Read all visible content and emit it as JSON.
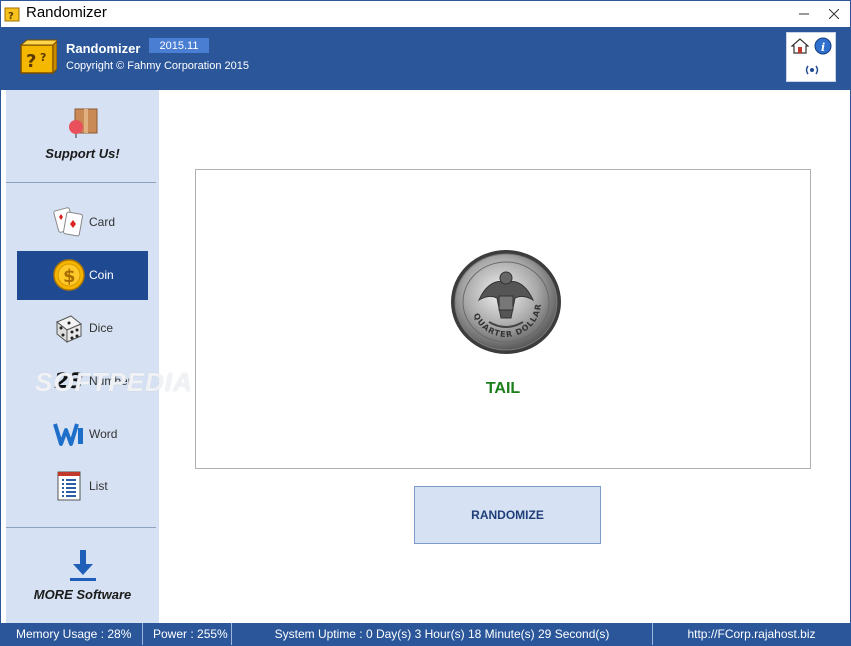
{
  "window": {
    "title": "Randomizer"
  },
  "header": {
    "app_name": "Randomizer",
    "version": "2015.11",
    "copyright": "Copyright © Fahmy Corporation 2015"
  },
  "sidebar": {
    "support_label": "Support Us!",
    "items": [
      {
        "label": "Card",
        "icon": "playing-cards-icon"
      },
      {
        "label": "Coin",
        "icon": "coin-icon",
        "active": true
      },
      {
        "label": "Dice",
        "icon": "dice-icon"
      },
      {
        "label": "Number",
        "icon": "number-icon",
        "glyph": "23"
      },
      {
        "label": "Word",
        "icon": "word-icon"
      },
      {
        "label": "List",
        "icon": "list-icon"
      }
    ],
    "more_label": "MORE Software"
  },
  "main": {
    "result": "TAIL",
    "randomize_label": "RANDOMIZE",
    "coin_text": "QUARTER DOLLAR"
  },
  "statusbar": {
    "memory": "Memory Usage : 28%",
    "power": "Power : 255%",
    "uptime": "System Uptime : 0 Day(s) 3 Hour(s) 18 Minute(s) 29 Second(s)",
    "url": "http://FCorp.rajahost.biz"
  },
  "watermark": "SOFTPEDIA",
  "colors": {
    "banner": "#2b579a",
    "sidebar": "#d6e2f3",
    "active_item": "#1f4a92",
    "result_text": "#1a7f1a"
  }
}
